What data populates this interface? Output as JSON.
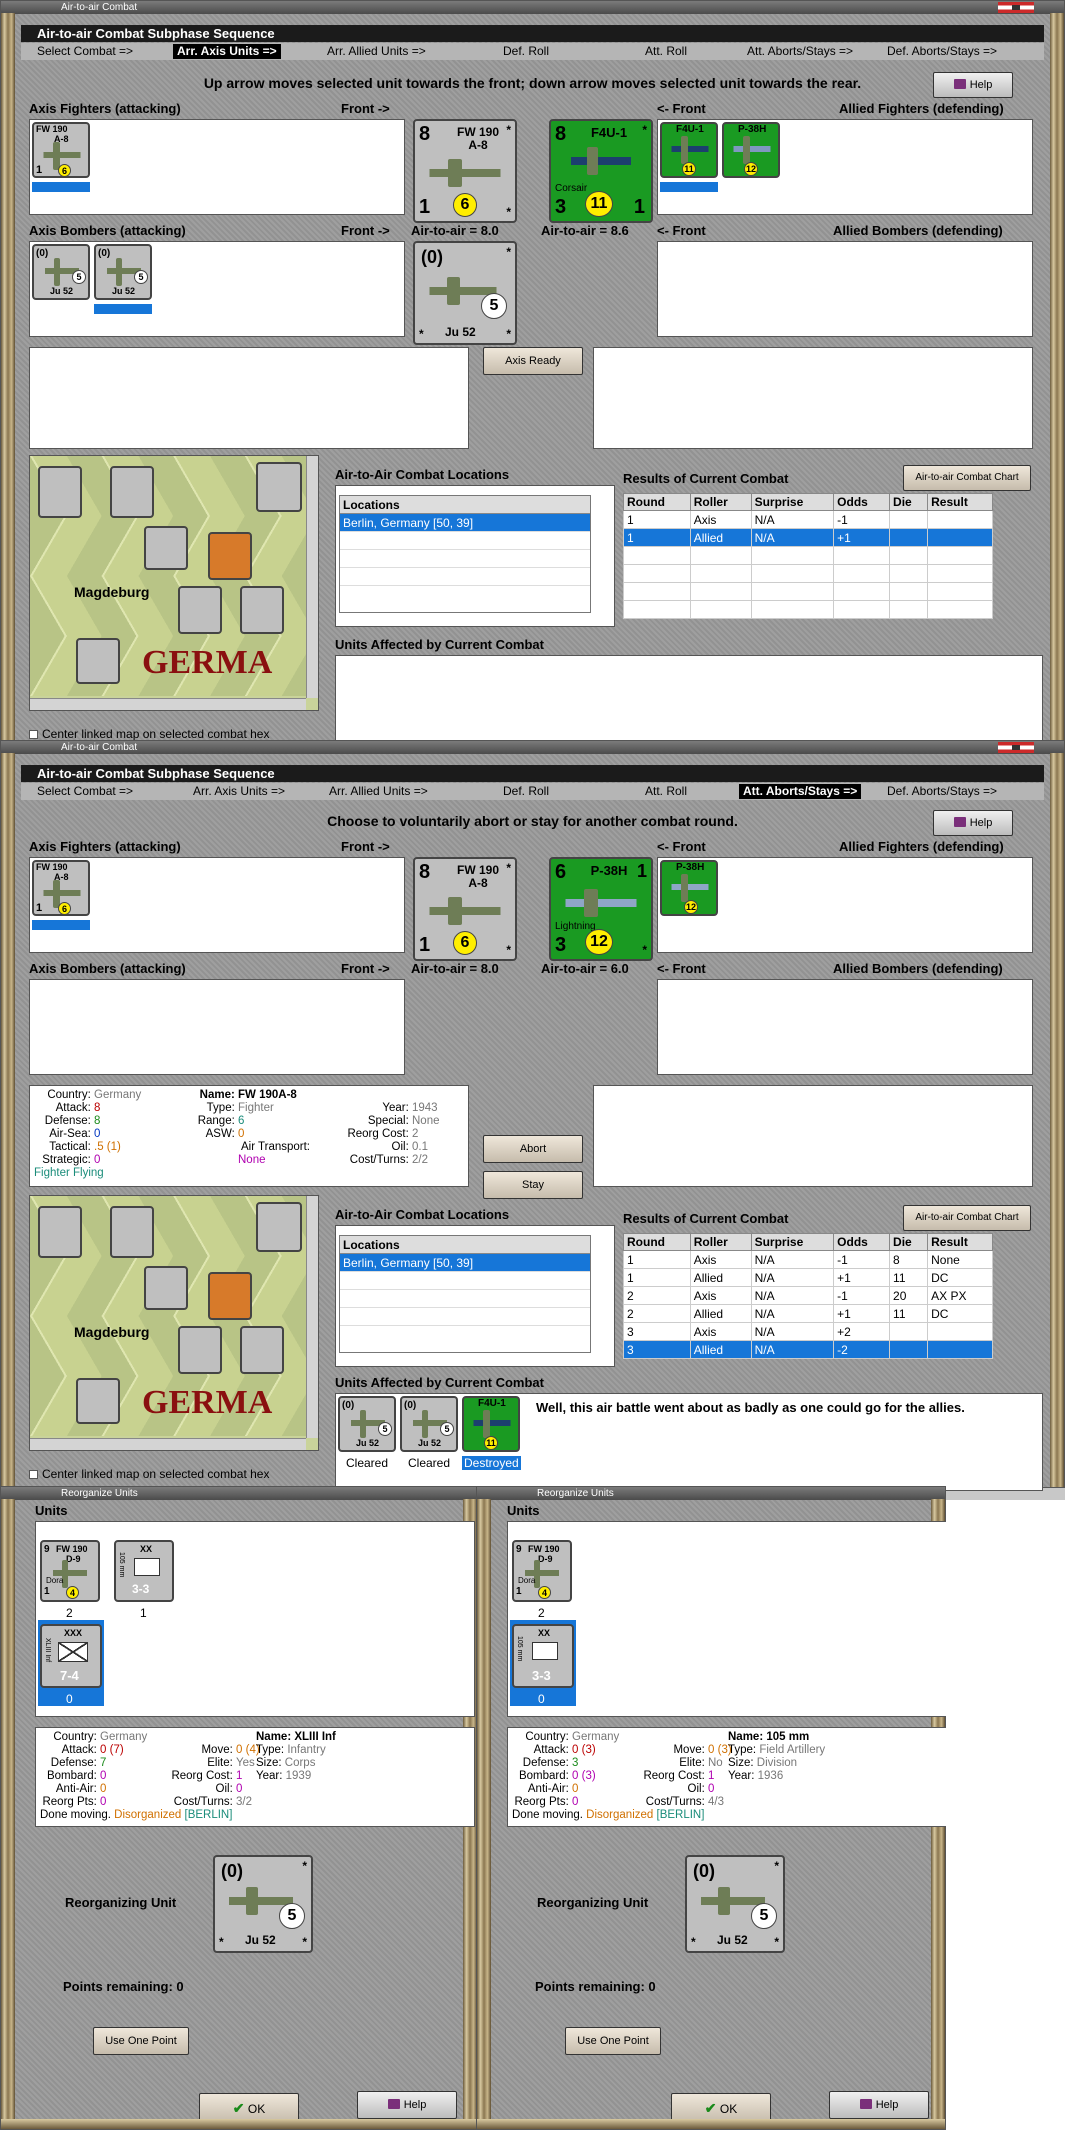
{
  "win1": {
    "title": "Air-to-air Combat",
    "subphase_title": "Air-to-air Combat Subphase Sequence",
    "steps": [
      "Select Combat =>",
      "Arr. Axis Units =>",
      "Arr. Allied Units =>",
      "Def. Roll",
      "Att. Roll",
      "Att. Aborts/Stays =>",
      "Def. Aborts/Stays =>"
    ],
    "instruction": "Up arrow moves selected unit towards the front; down arrow moves selected unit towards the rear.",
    "help_label": "Help",
    "axis_fighters_label": "Axis Fighters (attacking)",
    "front_right_label": "Front ->",
    "front_left_label": "<- Front",
    "allied_fighters_label": "Allied Fighters (defending)",
    "axis_bombers_label": "Axis Bombers (attacking)",
    "allied_bombers_label": "Allied Bombers (defending)",
    "axis_air_value": "Air-to-air = 8.0",
    "allied_air_value": "Air-to-air = 8.6",
    "axis_ready_label": "Axis Ready",
    "locations_title": "Air-to-Air Combat Locations",
    "locations_header": "Locations",
    "location_row": "Berlin, Germany [50, 39]",
    "results_title": "Results of Current Combat",
    "chart_button": "Air-to-air Combat Chart",
    "results_headers": [
      "Round",
      "Roller",
      "Surprise",
      "Odds",
      "Die",
      "Result"
    ],
    "results_rows": [
      [
        "1",
        "Axis",
        "N/A",
        "-1",
        "",
        ""
      ],
      [
        "1",
        "Allied",
        "N/A",
        "+1",
        "",
        ""
      ]
    ],
    "units_affected_title": "Units Affected by Current Combat",
    "center_map_label": "Center linked map on selected combat hex",
    "map_city": "Magdeburg",
    "map_country": "GERMA"
  },
  "win2": {
    "title": "Air-to-air Combat",
    "subphase_title": "Air-to-air Combat Subphase Sequence",
    "steps": [
      "Select Combat =>",
      "Arr. Axis Units =>",
      "Arr. Allied Units =>",
      "Def. Roll",
      "Att. Roll",
      "Att. Aborts/Stays =>",
      "Def. Aborts/Stays =>"
    ],
    "instruction": "Choose to voluntarily abort or stay for another combat round.",
    "help_label": "Help",
    "axis_fighters_label": "Axis Fighters (attacking)",
    "front_right_label": "Front ->",
    "front_left_label": "<- Front",
    "allied_fighters_label": "Allied Fighters (defending)",
    "axis_bombers_label": "Axis Bombers (attacking)",
    "allied_bombers_label": "Allied Bombers (defending)",
    "axis_air_value": "Air-to-air = 8.0",
    "allied_air_value": "Air-to-air = 6.0",
    "abort_label": "Abort",
    "stay_label": "Stay",
    "info": {
      "country_k": "Country:",
      "country_v": "Germany",
      "attack_k": "Attack:",
      "attack_v": "8",
      "defense_k": "Defense:",
      "defense_v": "8",
      "airsea_k": "Air-Sea:",
      "airsea_v": "0",
      "tactical_k": "Tactical:",
      "tactical_v": ".5 (1)",
      "strategic_k": "Strategic:",
      "strategic_v": "0",
      "flying": "Fighter Flying",
      "name_k": "Name:",
      "name_v": "FW 190A-8",
      "type_k": "Type:",
      "type_v": "Fighter",
      "range_k": "Range:",
      "range_v": "6",
      "asw_k": "ASW:",
      "asw_v": "0",
      "airtrans_k": "Air Transport:",
      "airtrans_v": "None",
      "year_k": "Year:",
      "year_v": "1943",
      "special_k": "Special:",
      "special_v": "None",
      "reorg_k": "Reorg Cost:",
      "reorg_v": "2",
      "oil_k": "Oil:",
      "oil_v": "0.1",
      "cost_k": "Cost/Turns:",
      "cost_v": "2/2"
    },
    "locations_title": "Air-to-Air Combat Locations",
    "locations_header": "Locations",
    "location_row": "Berlin, Germany [50, 39]",
    "results_title": "Results of Current Combat",
    "chart_button": "Air-to-air Combat Chart",
    "results_headers": [
      "Round",
      "Roller",
      "Surprise",
      "Odds",
      "Die",
      "Result"
    ],
    "results_rows": [
      [
        "1",
        "Axis",
        "N/A",
        "-1",
        "8",
        "None"
      ],
      [
        "1",
        "Allied",
        "N/A",
        "+1",
        "11",
        "DC"
      ],
      [
        "2",
        "Axis",
        "N/A",
        "-1",
        "20",
        "AX PX"
      ],
      [
        "2",
        "Allied",
        "N/A",
        "+1",
        "11",
        "DC"
      ],
      [
        "3",
        "Axis",
        "N/A",
        "+2",
        "",
        ""
      ],
      [
        "3",
        "Allied",
        "N/A",
        "-2",
        "",
        ""
      ]
    ],
    "units_affected_title": "Units Affected by Current Combat",
    "affected_labels": [
      "Cleared",
      "Cleared",
      "Destroyed"
    ],
    "comment": "Well, this air battle went about as badly as one could go for the allies.",
    "center_map_label": "Center linked map on selected combat hex",
    "map_city": "Magdeburg",
    "map_country": "GERMA"
  },
  "reorg1": {
    "title": "Reorganize Units",
    "units_label": "Units",
    "unit_counts": [
      "2",
      "1",
      "0"
    ],
    "info": {
      "country_k": "Country:",
      "country_v": "Germany",
      "attack_k": "Attack:",
      "attack_v": "0",
      "attack_x": "(7)",
      "defense_k": "Defense:",
      "defense_v": "7",
      "bombard_k": "Bombard:",
      "bombard_v": "0",
      "antiair_k": "Anti-Air:",
      "antiair_v": "0",
      "reorgpts_k": "Reorg Pts:",
      "reorgpts_v": "0",
      "move_k": "Move:",
      "move_v": "0",
      "move_x": "(4)",
      "elite_k": "Elite:",
      "elite_v": "Yes",
      "reorgc_k": "Reorg Cost:",
      "reorgc_v": "1",
      "oil_k": "Oil:",
      "oil_v": "0",
      "cost_k": "Cost/Turns:",
      "cost_v": "3/2",
      "name_k": "Name:",
      "name_v": "XLIII Inf",
      "type_k": "Type:",
      "type_v": "Infantry",
      "size_k": "Size:",
      "size_v": "Corps",
      "year_k": "Year:",
      "year_v": "1939",
      "done": "Done moving.",
      "disorg": "Disorganized",
      "loc": "[BERLIN]"
    },
    "reorganizing_label": "Reorganizing Unit",
    "points_label": "Points remaining:",
    "points_value": "0",
    "use_point": "Use One Point",
    "ok_label": "OK",
    "help_label": "Help"
  },
  "reorg2": {
    "title": "Reorganize Units",
    "units_label": "Units",
    "unit_counts": [
      "2",
      "0"
    ],
    "info": {
      "country_k": "Country:",
      "country_v": "Germany",
      "attack_k": "Attack:",
      "attack_v": "0",
      "attack_x": "(3)",
      "defense_k": "Defense:",
      "defense_v": "3",
      "bombard_k": "Bombard:",
      "bombard_v": "0",
      "bombard_x": "(3)",
      "antiair_k": "Anti-Air:",
      "antiair_v": "0",
      "reorgpts_k": "Reorg Pts:",
      "reorgpts_v": "0",
      "move_k": "Move:",
      "move_v": "0",
      "move_x": "(3)",
      "elite_k": "Elite:",
      "elite_v": "No",
      "reorgc_k": "Reorg Cost:",
      "reorgc_v": "1",
      "oil_k": "Oil:",
      "oil_v": "0",
      "cost_k": "Cost/Turns:",
      "cost_v": "4/3",
      "name_k": "Name:",
      "name_v": "105 mm",
      "type_k": "Type:",
      "type_v": "Field Artillery",
      "size_k": "Size:",
      "size_v": "Division",
      "year_k": "Year:",
      "year_v": "1936",
      "done": "Done moving.",
      "disorg": "Disorganized",
      "loc": "[BERLIN]"
    },
    "reorganizing_label": "Reorganizing Unit",
    "points_label": "Points remaining:",
    "points_value": "0",
    "use_point": "Use One Point",
    "ok_label": "OK",
    "help_label": "Help"
  },
  "counters": {
    "fw190_name": "FW 190",
    "fw190_model": "A-8",
    "fw190_att": "8",
    "fw190_def": "1",
    "fw190_air": "6",
    "f4u_name": "F4U-1",
    "f4u_sub": "Corsair",
    "f4u_att": "8",
    "f4u_def": "3",
    "f4u_air": "11",
    "f4u_r": "1",
    "p38_name": "P-38H",
    "p38_sub": "Lightning",
    "p38_att": "6",
    "p38_def": "3",
    "p38_air": "12",
    "p38_r": "1",
    "ju52_name": "Ju 52",
    "ju52_att": "(0)",
    "ju52_def": "5",
    "fw190d_name": "FW 190",
    "fw190d_model": "D-9",
    "fw190d_sub": "Dora",
    "fw190d_att": "9",
    "fw190d_def": "1",
    "fw190d_air": "4",
    "art_top": "XX",
    "art_side": "105 mm",
    "art_str": "3-3",
    "inf_top": "XXX",
    "inf_side": "XLIII Inf",
    "inf_str": "7-4",
    "star": "*"
  }
}
